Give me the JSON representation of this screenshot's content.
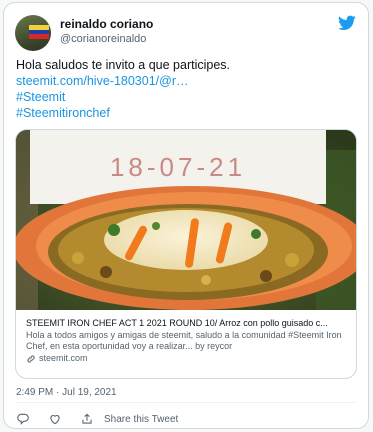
{
  "author": {
    "name": "reinaldo coriano",
    "handle": "@corianoreinaldo",
    "flag_colors": [
      "#f4d03f",
      "#1f3fa6",
      "#d62828"
    ]
  },
  "brand": {
    "icon": "twitter-bird-icon",
    "color": "#1d9bf0"
  },
  "tweet": {
    "text": "Hola saludos te invito a que participes.",
    "link": "steemit.com/hive-180301/@r…",
    "hashtags": [
      "#Steemit",
      "#Steemitironchef"
    ]
  },
  "photo": {
    "sign_text": "18-07-21"
  },
  "link_preview": {
    "title": "STEEMIT IRON CHEF ACT 1 2021 ROUND 10/ Arroz con pollo guisado c...",
    "description": "Hola a todos amigos y amigas de steemit, saludo a la comunidad #Steemit Iron Chef, en esta oportunidad voy a realizar... by reycor",
    "domain": "steemit.com",
    "domain_icon": "link-icon"
  },
  "timestamp": "2:49 PM · Jul 19, 2021",
  "actions": {
    "reply_icon": "reply-icon",
    "like_icon": "heart-icon",
    "share_icon": "share-icon",
    "share_label": "Share this Tweet"
  }
}
